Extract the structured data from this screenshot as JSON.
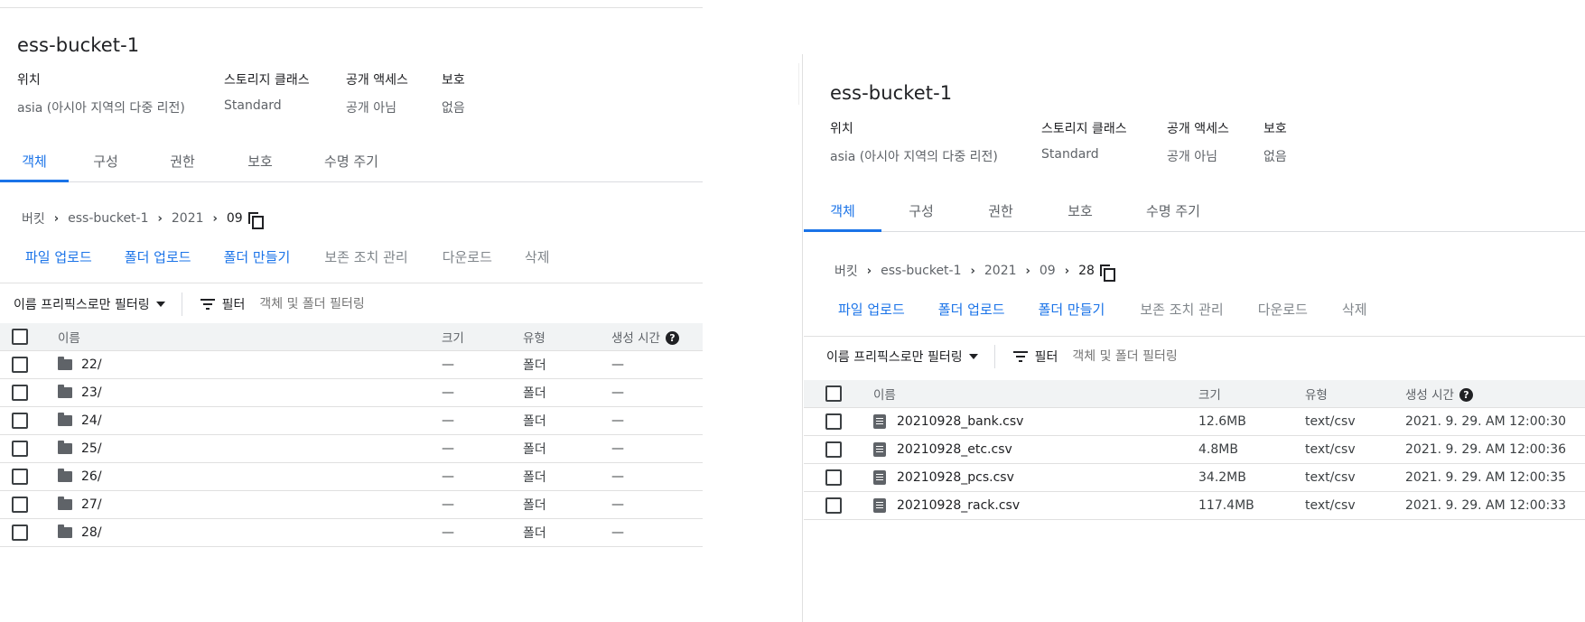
{
  "left": {
    "bucket_title": "ess-bucket-1",
    "meta": [
      {
        "label": "위치",
        "value": "asia (아시아 지역의 다중 리전)"
      },
      {
        "label": "스토리지 클래스",
        "value": "Standard"
      },
      {
        "label": "공개 액세스",
        "value": "공개 아님"
      },
      {
        "label": "보호",
        "value": "없음"
      }
    ],
    "tabs": [
      "객체",
      "구성",
      "권한",
      "보호",
      "수명 주기"
    ],
    "active_tab": "객체",
    "breadcrumb": [
      "버킷",
      "ess-bucket-1",
      "2021",
      "09"
    ],
    "actions": {
      "upload_file": "파일 업로드",
      "upload_folder": "폴더 업로드",
      "create_folder": "폴더 만들기",
      "retention": "보존 조치 관리",
      "download": "다운로드",
      "delete": "삭제"
    },
    "filter": {
      "prefix_label": "이름 프리픽스로만 필터링",
      "filter_label": "필터",
      "placeholder": "객체 및 폴더 필터링"
    },
    "columns": {
      "name": "이름",
      "size": "크기",
      "type": "유형",
      "created": "생성 시간"
    },
    "rows": [
      {
        "name": "22/",
        "size": "—",
        "type": "폴더",
        "created": "—"
      },
      {
        "name": "23/",
        "size": "—",
        "type": "폴더",
        "created": "—"
      },
      {
        "name": "24/",
        "size": "—",
        "type": "폴더",
        "created": "—"
      },
      {
        "name": "25/",
        "size": "—",
        "type": "폴더",
        "created": "—"
      },
      {
        "name": "26/",
        "size": "—",
        "type": "폴더",
        "created": "—"
      },
      {
        "name": "27/",
        "size": "—",
        "type": "폴더",
        "created": "—"
      },
      {
        "name": "28/",
        "size": "—",
        "type": "폴더",
        "created": "—"
      }
    ]
  },
  "right": {
    "bucket_title": "ess-bucket-1",
    "meta": [
      {
        "label": "위치",
        "value": "asia (아시아 지역의 다중 리전)"
      },
      {
        "label": "스토리지 클래스",
        "value": "Standard"
      },
      {
        "label": "공개 액세스",
        "value": "공개 아님"
      },
      {
        "label": "보호",
        "value": "없음"
      }
    ],
    "tabs": [
      "객체",
      "구성",
      "권한",
      "보호",
      "수명 주기"
    ],
    "active_tab": "객체",
    "breadcrumb": [
      "버킷",
      "ess-bucket-1",
      "2021",
      "09",
      "28"
    ],
    "actions": {
      "upload_file": "파일 업로드",
      "upload_folder": "폴더 업로드",
      "create_folder": "폴더 만들기",
      "retention": "보존 조치 관리",
      "download": "다운로드",
      "delete": "삭제"
    },
    "filter": {
      "prefix_label": "이름 프리픽스로만 필터링",
      "filter_label": "필터",
      "placeholder": "객체 및 폴더 필터링"
    },
    "columns": {
      "name": "이름",
      "size": "크기",
      "type": "유형",
      "created": "생성 시간"
    },
    "rows": [
      {
        "name": "20210928_bank.csv",
        "size": "12.6MB",
        "type": "text/csv",
        "created": "2021. 9. 29. AM 12:00:30"
      },
      {
        "name": "20210928_etc.csv",
        "size": "4.8MB",
        "type": "text/csv",
        "created": "2021. 9. 29. AM 12:00:36"
      },
      {
        "name": "20210928_pcs.csv",
        "size": "34.2MB",
        "type": "text/csv",
        "created": "2021. 9. 29. AM 12:00:35"
      },
      {
        "name": "20210928_rack.csv",
        "size": "117.4MB",
        "type": "text/csv",
        "created": "2021. 9. 29. AM 12:00:33"
      }
    ]
  },
  "colors": {
    "accent": "#1a73e8",
    "header_bg": "#f1f3f4",
    "muted": "#5f6368"
  }
}
